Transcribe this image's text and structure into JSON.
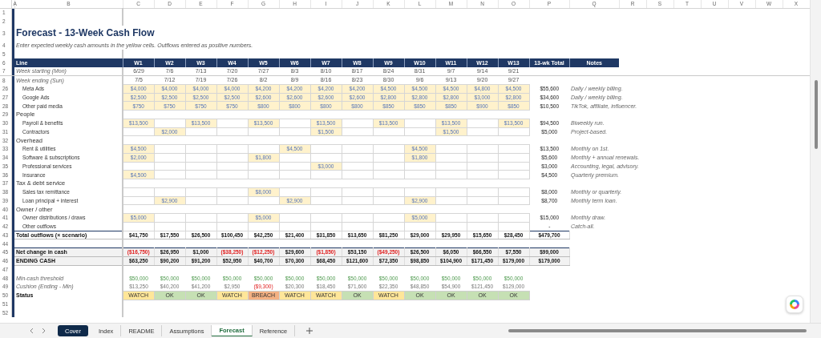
{
  "column_letters": [
    "A",
    "B",
    "C",
    "D",
    "E",
    "F",
    "G",
    "H",
    "I",
    "J",
    "K",
    "L",
    "M",
    "N",
    "O",
    "P",
    "Q",
    "R",
    "S",
    "T",
    "U",
    "V",
    "W",
    "X"
  ],
  "rows": [
    {
      "number": "1",
      "kind": "blank"
    },
    {
      "number": "2",
      "kind": "blank"
    },
    {
      "number": "3",
      "kind": "title",
      "label": "Forecast - 13-Week Cash Flow"
    },
    {
      "number": "4",
      "kind": "subtitle",
      "label": "Enter expected weekly cash amounts in the yellow cells. Outflows entered as positive numbers."
    },
    {
      "number": "5",
      "kind": "blank"
    },
    {
      "number": "6",
      "kind": "header",
      "cells": [
        "Line",
        "W1",
        "W2",
        "W3",
        "W4",
        "W5",
        "W6",
        "W7",
        "W8",
        "W9",
        "W10",
        "W11",
        "W12",
        "W13",
        "13-wk Total",
        "Notes"
      ]
    },
    {
      "number": "7",
      "kind": "dates",
      "label": "Week starting (Mon)",
      "cells": [
        "6/29",
        "7/6",
        "7/13",
        "7/20",
        "7/27",
        "8/3",
        "8/10",
        "8/17",
        "8/24",
        "8/31",
        "9/7",
        "9/14",
        "9/21"
      ]
    },
    {
      "number": "8",
      "kind": "dates",
      "label": "Week ending (Sun)",
      "cells": [
        "7/5",
        "7/12",
        "7/19",
        "7/26",
        "8/2",
        "8/9",
        "8/16",
        "8/23",
        "8/30",
        "9/6",
        "9/13",
        "9/20",
        "9/27"
      ]
    },
    {
      "number": "26",
      "kind": "line",
      "label": "Meta Ads",
      "cells": [
        "$4,000",
        "$4,000",
        "$4,000",
        "$4,000",
        "$4,200",
        "$4,200",
        "$4,200",
        "$4,200",
        "$4,500",
        "$4,500",
        "$4,500",
        "$4,800",
        "$4,500"
      ],
      "total": "$55,600",
      "note": "Daily / weekly billing."
    },
    {
      "number": "27",
      "kind": "line",
      "label": "Google Ads",
      "cells": [
        "$2,500",
        "$2,500",
        "$2,500",
        "$2,500",
        "$2,600",
        "$2,600",
        "$2,600",
        "$2,600",
        "$2,800",
        "$2,800",
        "$2,800",
        "$3,000",
        "$2,800"
      ],
      "total": "$34,600",
      "note": "Daily / weekly billing."
    },
    {
      "number": "28",
      "kind": "line",
      "label": "Other paid media",
      "cells": [
        "$750",
        "$750",
        "$750",
        "$750",
        "$800",
        "$800",
        "$800",
        "$800",
        "$850",
        "$850",
        "$850",
        "$900",
        "$850"
      ],
      "total": "$10,500",
      "note": "TikTok, affiliate, influencer."
    },
    {
      "number": "29",
      "kind": "section",
      "label": "People"
    },
    {
      "number": "30",
      "kind": "line",
      "label": "Payroll & benefits",
      "cells": [
        "$13,500",
        null,
        "$13,500",
        null,
        "$13,500",
        null,
        "$13,500",
        null,
        "$13,500",
        null,
        "$13,500",
        null,
        "$13,500"
      ],
      "total": "$94,500",
      "note": "Biweekly run."
    },
    {
      "number": "31",
      "kind": "line",
      "label": "Contractors",
      "cells": [
        null,
        "$2,000",
        null,
        null,
        null,
        null,
        "$1,500",
        null,
        null,
        null,
        "$1,500",
        null,
        null
      ],
      "total": "$5,000",
      "note": "Project-based."
    },
    {
      "number": "32",
      "kind": "section",
      "label": "Overhead"
    },
    {
      "number": "33",
      "kind": "line",
      "label": "Rent & utilities",
      "cells": [
        "$4,500",
        null,
        null,
        null,
        null,
        "$4,500",
        null,
        null,
        null,
        "$4,500",
        null,
        null,
        null
      ],
      "total": "$13,500",
      "note": "Monthly on 1st."
    },
    {
      "number": "34",
      "kind": "line",
      "label": "Software & subscriptions",
      "cells": [
        "$2,000",
        null,
        null,
        null,
        "$1,800",
        null,
        null,
        null,
        null,
        "$1,800",
        null,
        null,
        null
      ],
      "total": "$5,600",
      "note": "Monthly + annual renewals."
    },
    {
      "number": "35",
      "kind": "line",
      "label": "Professional services",
      "cells": [
        null,
        null,
        null,
        null,
        null,
        null,
        "$3,000",
        null,
        null,
        null,
        null,
        null,
        null
      ],
      "total": "$3,000",
      "note": "Accounting, legal, advisory."
    },
    {
      "number": "36",
      "kind": "line",
      "label": "Insurance",
      "cells": [
        "$4,500",
        null,
        null,
        null,
        null,
        null,
        null,
        null,
        null,
        null,
        null,
        null,
        null
      ],
      "total": "$4,500",
      "note": "Quarterly premium."
    },
    {
      "number": "37",
      "kind": "section",
      "label": "Tax & debt service"
    },
    {
      "number": "38",
      "kind": "line",
      "label": "Sales tax remittance",
      "cells": [
        null,
        null,
        null,
        null,
        "$8,000",
        null,
        null,
        null,
        null,
        null,
        null,
        null,
        null
      ],
      "total": "$8,000",
      "note": "Monthly or quarterly."
    },
    {
      "number": "39",
      "kind": "line",
      "label": "Loan principal + interest",
      "cells": [
        null,
        "$2,900",
        null,
        null,
        null,
        "$2,900",
        null,
        null,
        null,
        "$2,900",
        null,
        null,
        null
      ],
      "total": "$8,700",
      "note": "Monthly term loan."
    },
    {
      "number": "40",
      "kind": "section",
      "label": "Owner / other"
    },
    {
      "number": "41",
      "kind": "line",
      "label": "Owner distributions / draws",
      "cells": [
        "$5,000",
        null,
        null,
        null,
        "$5,000",
        null,
        null,
        null,
        null,
        "$5,000",
        null,
        null,
        null
      ],
      "total": "$15,000",
      "note": "Monthly draw."
    },
    {
      "number": "42",
      "kind": "line",
      "label": "Other outflows",
      "cells": [
        null,
        null,
        null,
        null,
        null,
        null,
        null,
        null,
        null,
        null,
        null,
        null,
        null
      ],
      "total": "-",
      "note": "Catch-all."
    },
    {
      "number": "43",
      "kind": "total",
      "label": "Total outflows (× scenario)",
      "cells": [
        "$41,750",
        "$17,550",
        "$26,500",
        "$100,450",
        "$42,250",
        "$21,400",
        "$31,850",
        "$13,650",
        "$81,250",
        "$29,000",
        "$29,950",
        "$15,650",
        "$28,450"
      ],
      "total": "$479,700"
    },
    {
      "number": "44",
      "kind": "blank"
    },
    {
      "number": "45",
      "kind": "net",
      "label": "Net change in cash",
      "cells": [
        {
          "value": "($16,750)",
          "negative": true
        },
        {
          "value": "$26,950",
          "negative": false
        },
        {
          "value": "$1,000",
          "negative": false
        },
        {
          "value": "($38,250)",
          "negative": true
        },
        {
          "value": "($12,250)",
          "negative": true
        },
        {
          "value": "$29,600",
          "negative": false
        },
        {
          "value": "($1,850)",
          "negative": true
        },
        {
          "value": "$53,150",
          "negative": false
        },
        {
          "value": "($49,250)",
          "negative": true
        },
        {
          "value": "$26,500",
          "negative": false
        },
        {
          "value": "$6,050",
          "negative": false
        },
        {
          "value": "$66,550",
          "negative": false
        },
        {
          "value": "$7,550",
          "negative": false
        }
      ],
      "total": "$99,000"
    },
    {
      "number": "46",
      "kind": "ending",
      "label": "ENDING CASH",
      "cells": [
        "$63,250",
        "$90,200",
        "$91,200",
        "$52,950",
        "$40,700",
        "$70,300",
        "$68,450",
        "$121,600",
        "$72,350",
        "$98,850",
        "$104,900",
        "$171,450",
        "$179,000"
      ],
      "total": "$179,000"
    },
    {
      "number": "47",
      "kind": "blank"
    },
    {
      "number": "48",
      "kind": "threshold",
      "label": "Min-cash threshold",
      "cells": [
        "$50,000",
        "$50,000",
        "$50,000",
        "$50,000",
        "$50,000",
        "$50,000",
        "$50,000",
        "$50,000",
        "$50,000",
        "$50,000",
        "$50,000",
        "$50,000",
        "$50,000"
      ]
    },
    {
      "number": "49",
      "kind": "cushion",
      "label": "Cushion (Ending - Min)",
      "cells": [
        {
          "value": "$13,250",
          "negative": false
        },
        {
          "value": "$40,200",
          "negative": false
        },
        {
          "value": "$41,200",
          "negative": false
        },
        {
          "value": "$2,950",
          "negative": false
        },
        {
          "value": "($9,300)",
          "negative": true
        },
        {
          "value": "$20,300",
          "negative": false
        },
        {
          "value": "$18,450",
          "negative": false
        },
        {
          "value": "$71,600",
          "negative": false
        },
        {
          "value": "$22,350",
          "negative": false
        },
        {
          "value": "$48,850",
          "negative": false
        },
        {
          "value": "$54,900",
          "negative": false
        },
        {
          "value": "$121,450",
          "negative": false
        },
        {
          "value": "$129,000",
          "negative": false
        }
      ]
    },
    {
      "number": "50",
      "kind": "status",
      "label": "Status",
      "cells": [
        {
          "label": "WATCH",
          "color": "#ffe699"
        },
        {
          "label": "OK",
          "color": "#c6e0b4"
        },
        {
          "label": "OK",
          "color": "#c6e0b4"
        },
        {
          "label": "WATCH",
          "color": "#ffe699"
        },
        {
          "label": "BREACH",
          "color": "#f4b183"
        },
        {
          "label": "WATCH",
          "color": "#ffe699"
        },
        {
          "label": "WATCH",
          "color": "#ffe699"
        },
        {
          "label": "OK",
          "color": "#c6e0b4"
        },
        {
          "label": "WATCH",
          "color": "#ffe699"
        },
        {
          "label": "OK",
          "color": "#c6e0b4"
        },
        {
          "label": "OK",
          "color": "#c6e0b4"
        },
        {
          "label": "OK",
          "color": "#c6e0b4"
        },
        {
          "label": "OK",
          "color": "#c6e0b4"
        }
      ]
    },
    {
      "number": "51",
      "kind": "blank"
    },
    {
      "number": "52",
      "kind": "blank"
    }
  ],
  "sheet_tabs": [
    {
      "label": "Cover",
      "selected": false,
      "color": "#0f2a4a"
    },
    {
      "label": "Index",
      "selected": false
    },
    {
      "label": "README",
      "selected": false
    },
    {
      "label": "Assumptions",
      "selected": false
    },
    {
      "label": "Forecast",
      "selected": true
    },
    {
      "label": "Reference",
      "selected": false
    }
  ]
}
